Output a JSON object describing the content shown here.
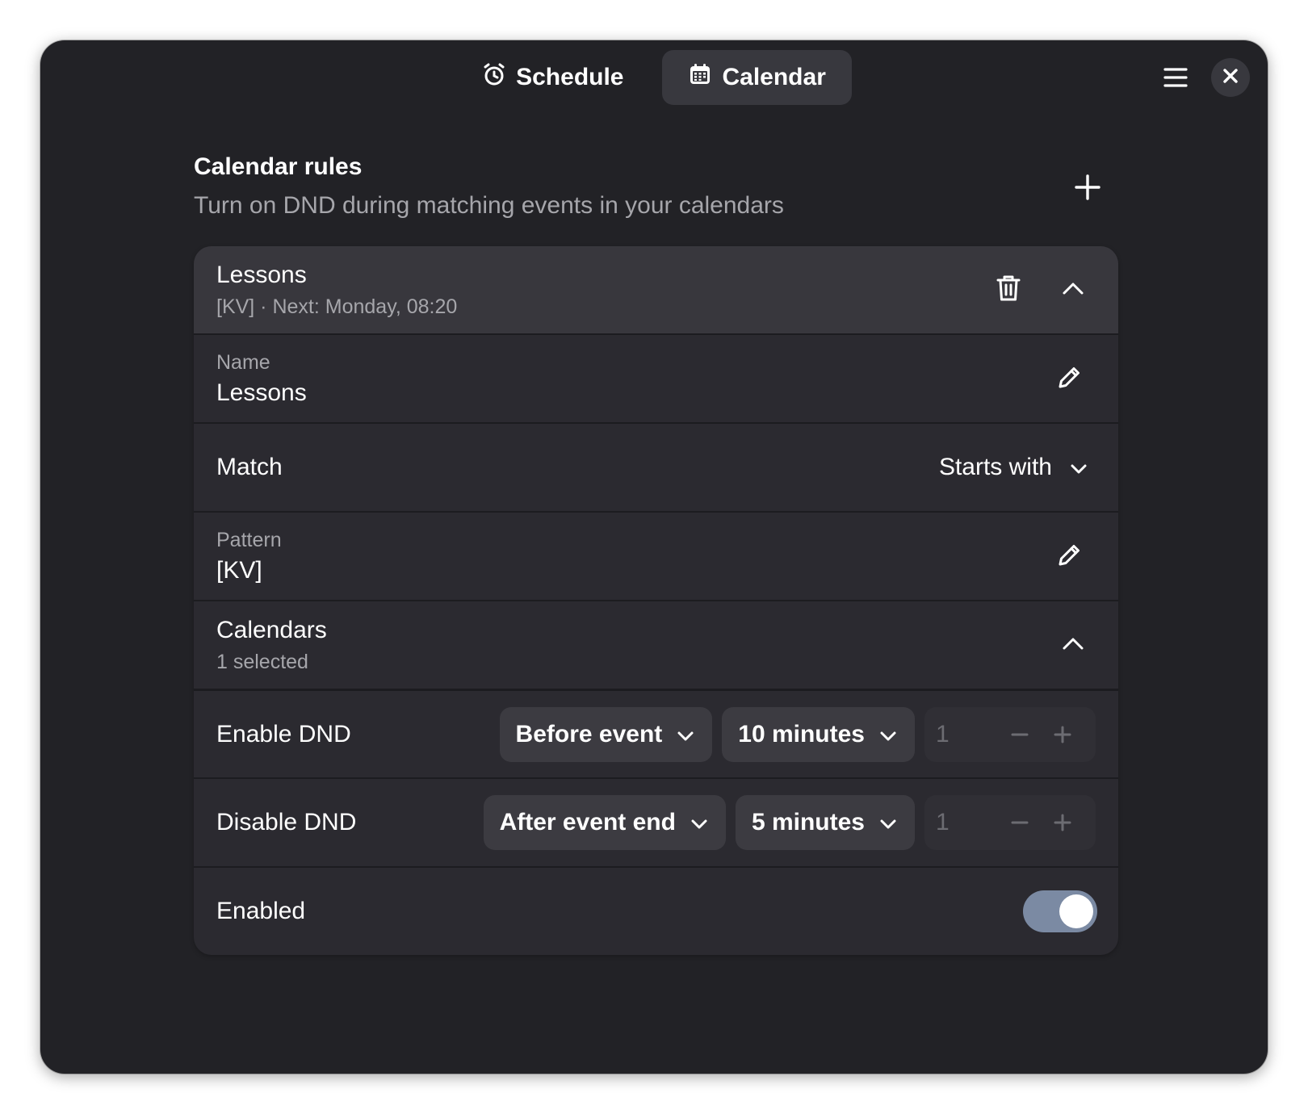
{
  "tabs": [
    {
      "label": "Schedule",
      "icon": "alarm-clock-icon",
      "active": false
    },
    {
      "label": "Calendar",
      "icon": "calendar-icon",
      "active": true
    }
  ],
  "header": {
    "menu_icon": "hamburger-menu-icon",
    "close_icon": "close-icon"
  },
  "section": {
    "title": "Calendar rules",
    "subtitle": "Turn on DND during matching events in your calendars",
    "add_icon": "plus-icon"
  },
  "rule": {
    "title": "Lessons",
    "summary": "[KV] · Next: Monday, 08:20",
    "name": {
      "label": "Name",
      "value": "Lessons"
    },
    "match": {
      "label": "Match",
      "value": "Starts with"
    },
    "pattern": {
      "label": "Pattern",
      "value": "[KV]"
    },
    "calendars": {
      "label": "Calendars",
      "value": "1 selected"
    },
    "enable_dnd": {
      "label": "Enable DND",
      "when": "Before event",
      "offset": "10 minutes",
      "count": "1"
    },
    "disable_dnd": {
      "label": "Disable DND",
      "when": "After event end",
      "offset": "5 minutes",
      "count": "1"
    },
    "enabled": {
      "label": "Enabled",
      "on": true
    }
  },
  "colors": {
    "window_bg": "#222226",
    "card_bg": "#2b2a30",
    "header_row_bg": "#38373d",
    "toggle_on": "#7b8aa3"
  }
}
